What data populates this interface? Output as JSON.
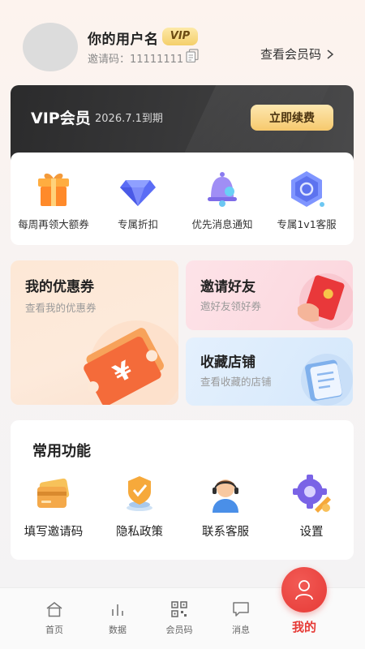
{
  "profile": {
    "username": "你的用户名",
    "vip_badge": "VIP",
    "invite_label": "邀请码：",
    "invite_code": "11111111",
    "member_code_link": "查看会员码"
  },
  "vip_card": {
    "title": "VIP会员",
    "expire_text": "2026.7.1到期",
    "renew_button": "立即续费"
  },
  "benefits": [
    {
      "label": "每周再领大额券",
      "icon": "gift-icon"
    },
    {
      "label": "专属折扣",
      "icon": "diamond-icon"
    },
    {
      "label": "优先消息通知",
      "icon": "bell-icon"
    },
    {
      "label": "专属1v1客服",
      "icon": "customer-service-icon"
    }
  ],
  "coupon_card": {
    "title": "我的优惠券",
    "subtitle": "查看我的优惠券",
    "icon": "coupon-ticket-icon"
  },
  "invite_card": {
    "title": "邀请好友",
    "subtitle": "邀好友领好券",
    "icon": "red-envelope-icon"
  },
  "favorites_card": {
    "title": "收藏店铺",
    "subtitle": "查看收藏的店铺",
    "icon": "wallet-icon"
  },
  "functions": {
    "title": "常用功能",
    "items": [
      {
        "label": "填写邀请码",
        "icon": "card-icon"
      },
      {
        "label": "隐私政策",
        "icon": "shield-icon"
      },
      {
        "label": "联系客服",
        "icon": "support-agent-icon"
      },
      {
        "label": "设置",
        "icon": "settings-gear-icon"
      }
    ]
  },
  "bottom_nav": [
    {
      "label": "首页",
      "icon": "home-icon"
    },
    {
      "label": "数据",
      "icon": "bar-chart-icon"
    },
    {
      "label": "会员码",
      "icon": "qr-code-icon"
    },
    {
      "label": "消息",
      "icon": "message-icon"
    },
    {
      "label": "我的",
      "icon": "user-icon",
      "active": true
    }
  ],
  "colors": {
    "accent_red": "#e63a36",
    "vip_gold": "#f6c96d",
    "vip_dark": "#2b2b2c"
  }
}
